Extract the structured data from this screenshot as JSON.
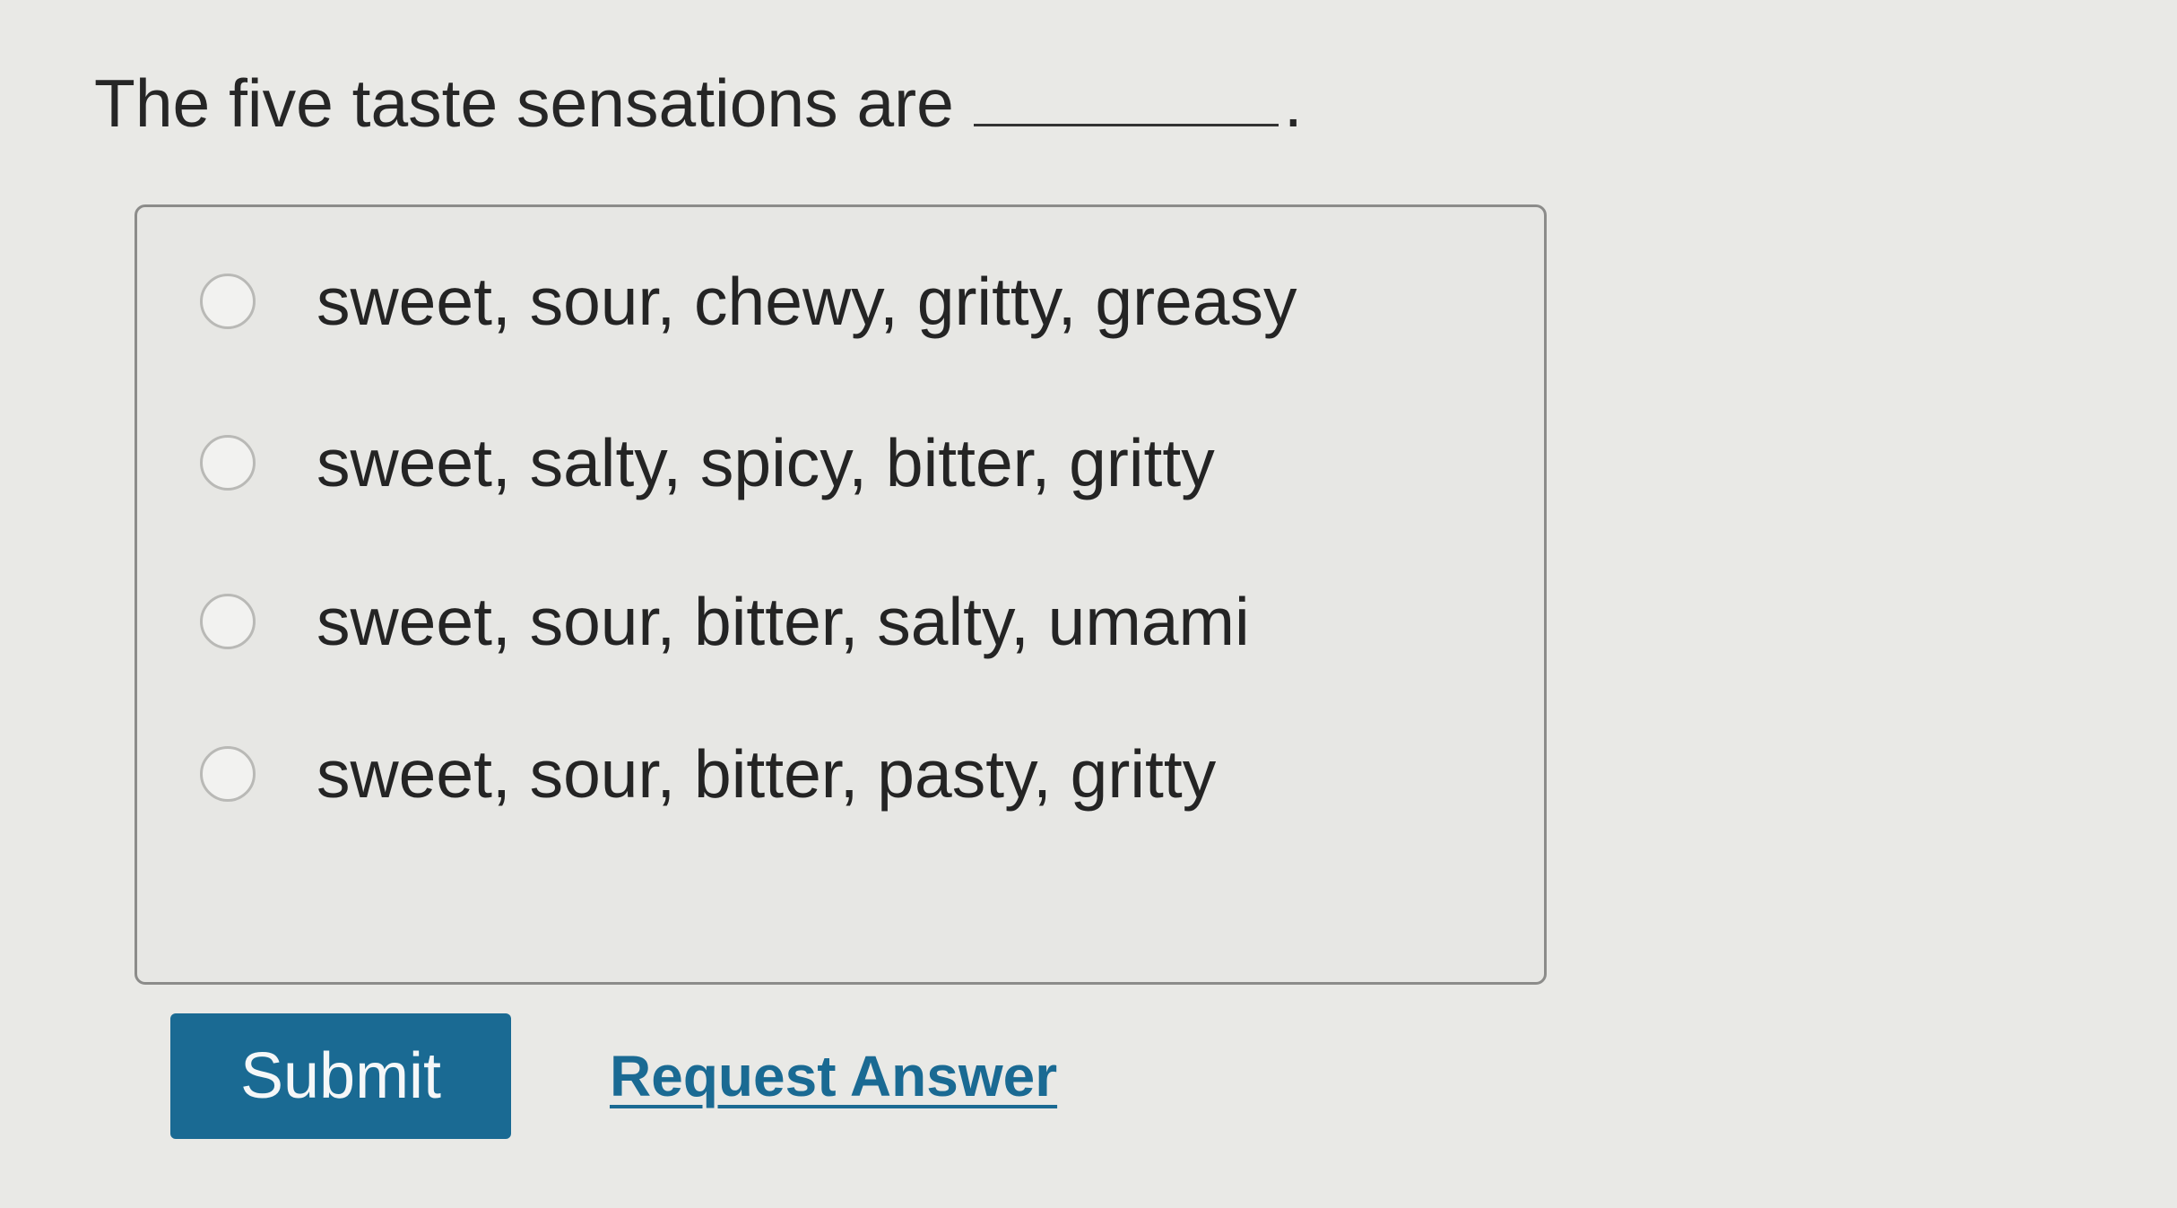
{
  "question": {
    "text": "The five taste sensations are",
    "terminator": "."
  },
  "choices": [
    {
      "label": "sweet, sour, chewy, gritty, greasy",
      "selected": false
    },
    {
      "label": "sweet, salty, spicy, bitter, gritty",
      "selected": false
    },
    {
      "label": "sweet, sour, bitter, salty, umami",
      "selected": false
    },
    {
      "label": "sweet, sour, bitter, pasty, gritty",
      "selected": false
    }
  ],
  "actions": {
    "submit_label": "Submit",
    "request_answer_label": "Request Answer"
  },
  "colors": {
    "accent": "#1a6a93",
    "background": "#e9e9e6"
  }
}
